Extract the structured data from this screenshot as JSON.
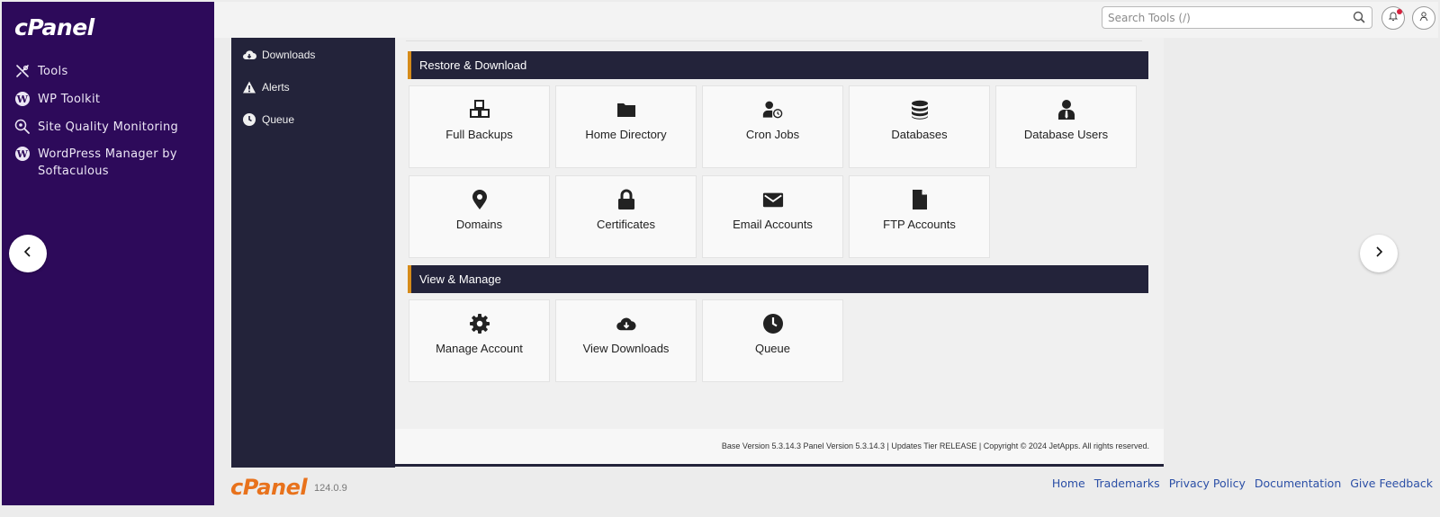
{
  "sidebar": {
    "logo": "cPanel",
    "items": [
      {
        "label": "Tools",
        "icon": "tools-icon"
      },
      {
        "label": "WP Toolkit",
        "icon": "wordpress-icon"
      },
      {
        "label": "Site Quality Monitoring",
        "icon": "search-gear-icon"
      },
      {
        "label": "WordPress Manager by Softaculous",
        "icon": "wordpress-icon"
      }
    ]
  },
  "topbar": {
    "search_placeholder": "Search Tools (/)"
  },
  "plugin_nav": {
    "items": [
      {
        "label": "Downloads",
        "icon": "cloud-download-icon"
      },
      {
        "label": "Alerts",
        "icon": "warning-icon"
      },
      {
        "label": "Queue",
        "icon": "clock-icon"
      }
    ]
  },
  "sections": [
    {
      "title": "Restore & Download",
      "tiles": [
        {
          "label": "Full Backups",
          "icon": "cubes-icon"
        },
        {
          "label": "Home Directory",
          "icon": "folder-icon"
        },
        {
          "label": "Cron Jobs",
          "icon": "user-clock-icon"
        },
        {
          "label": "Databases",
          "icon": "database-icon"
        },
        {
          "label": "Database Users",
          "icon": "user-tie-icon"
        },
        {
          "label": "Domains",
          "icon": "map-marker-icon"
        },
        {
          "label": "Certificates",
          "icon": "lock-icon"
        },
        {
          "label": "Email Accounts",
          "icon": "envelope-icon"
        },
        {
          "label": "FTP Accounts",
          "icon": "file-icon"
        }
      ]
    },
    {
      "title": "View & Manage",
      "tiles": [
        {
          "label": "Manage Account",
          "icon": "cog-icon"
        },
        {
          "label": "View Downloads",
          "icon": "cloud-download-icon"
        },
        {
          "label": "Queue",
          "icon": "clock-icon"
        }
      ]
    }
  ],
  "footer": {
    "version_text": "Base Version 5.3.14.3 Panel Version 5.3.14.3 | Updates Tier RELEASE | Copyright © 2024 JetApps. All rights reserved.",
    "cpanel_logo": "cPanel",
    "cpanel_version": "124.0.9",
    "links": [
      "Home",
      "Trademarks",
      "Privacy Policy",
      "Documentation",
      "Give Feedback"
    ]
  },
  "colors": {
    "sidebar_bg": "#2d0a5a",
    "dark_panel": "#23233a",
    "accent_orange": "#d68b1a",
    "logo_orange": "#e8721c",
    "link_blue": "#2b4fa6"
  }
}
